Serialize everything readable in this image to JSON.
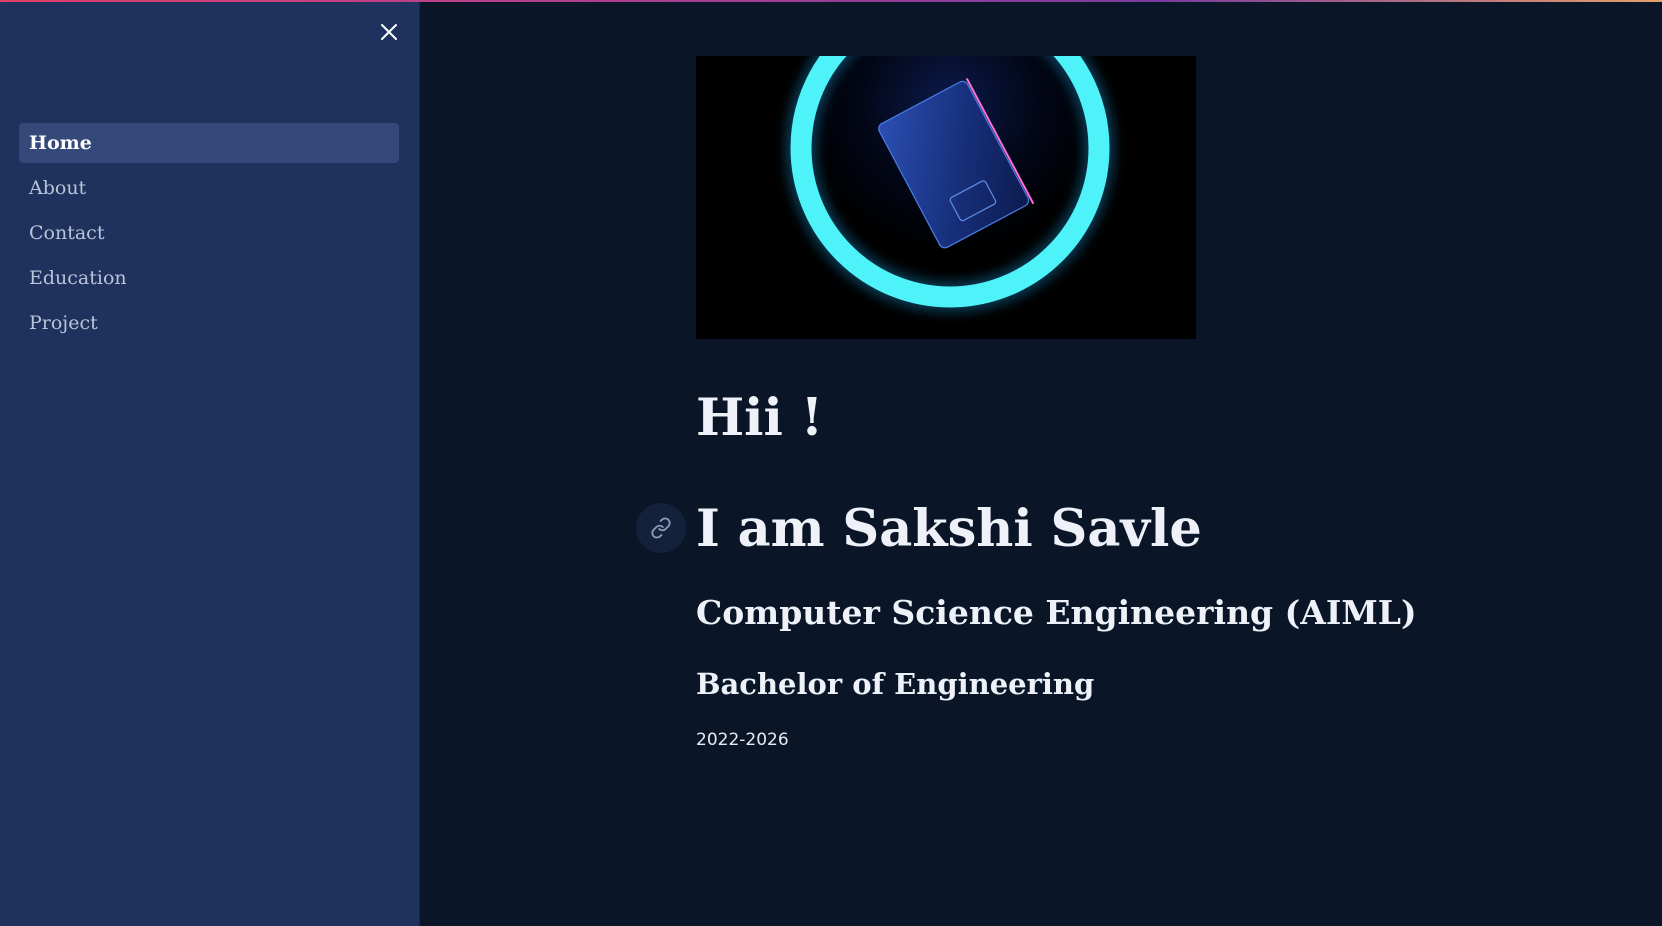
{
  "sidebar": {
    "close_icon": "close-icon",
    "items": [
      {
        "label": "Home",
        "active": true
      },
      {
        "label": "About",
        "active": false
      },
      {
        "label": "Contact",
        "active": false
      },
      {
        "label": "Education",
        "active": false
      },
      {
        "label": "Project",
        "active": false
      }
    ]
  },
  "main": {
    "hero_image": "laptop-in-neon-ring-image",
    "greeting": "Hii !",
    "name_heading": "I am Sakshi Savle",
    "anchor_icon": "link-icon",
    "field": "Computer Science Engineering (AIML)",
    "program": "Bachelor of Engineering",
    "years": "2022-2026"
  },
  "colors": {
    "sidebar_bg": "#1e325d",
    "active_item_bg": "#34497a",
    "main_bg": "#0a1628",
    "neon_ring": "#4ef2f9",
    "text": "#eef2f8"
  }
}
